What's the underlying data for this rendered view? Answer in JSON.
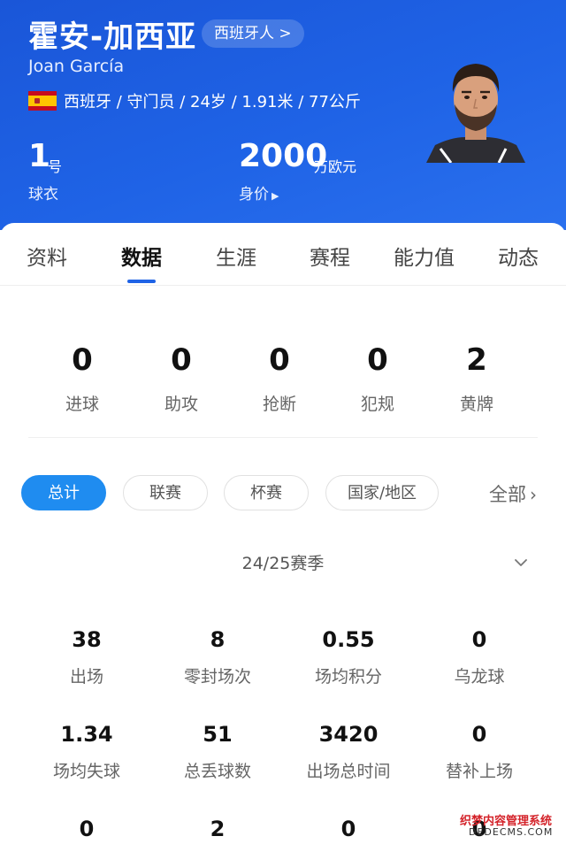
{
  "player": {
    "name": "霍安-加西亚",
    "nation_link": "西班牙人 >",
    "latin_name": "Joan García",
    "info": "西班牙 / 守门员 / 24岁 / 1.91米 / 77公斤",
    "jersey_number": "1",
    "jersey_unit": "号",
    "jersey_label": "球衣",
    "market_value": "2000",
    "market_value_unit": "万欧元",
    "market_value_label": "身价",
    "market_value_arrow": "▶"
  },
  "tabs": [
    "资料",
    "数据",
    "生涯",
    "赛程",
    "能力值",
    "动态"
  ],
  "active_tab": "数据",
  "summary_stats": [
    {
      "value": "0",
      "label": "进球"
    },
    {
      "value": "0",
      "label": "助攻"
    },
    {
      "value": "0",
      "label": "抢断"
    },
    {
      "value": "0",
      "label": "犯规"
    },
    {
      "value": "2",
      "label": "黄牌"
    }
  ],
  "filters": {
    "pills": [
      "总计",
      "联赛",
      "杯赛",
      "国家/地区"
    ],
    "active": "总计",
    "all_label": "全部",
    "all_chevron": "›"
  },
  "season": "24/25赛季",
  "stats_grid": [
    {
      "value": "38",
      "label": "出场"
    },
    {
      "value": "8",
      "label": "零封场次"
    },
    {
      "value": "0.55",
      "label": "场均积分"
    },
    {
      "value": "0",
      "label": "乌龙球"
    },
    {
      "value": "1.34",
      "label": "场均失球"
    },
    {
      "value": "51",
      "label": "总丢球数"
    },
    {
      "value": "3420",
      "label": "出场总时间"
    },
    {
      "value": "0",
      "label": "替补上场"
    },
    {
      "value": "0",
      "label": ""
    },
    {
      "value": "2",
      "label": ""
    },
    {
      "value": "0",
      "label": ""
    },
    {
      "value": "0",
      "label": ""
    }
  ],
  "watermark": {
    "line1": "织梦内容管理系统",
    "line2": "DEDECMS.COM"
  },
  "colors": {
    "header_blue": "#1f63e6",
    "accent_blue": "#1f8cf0",
    "flag_red": "#c60b1e",
    "flag_yellow": "#ffc400"
  }
}
